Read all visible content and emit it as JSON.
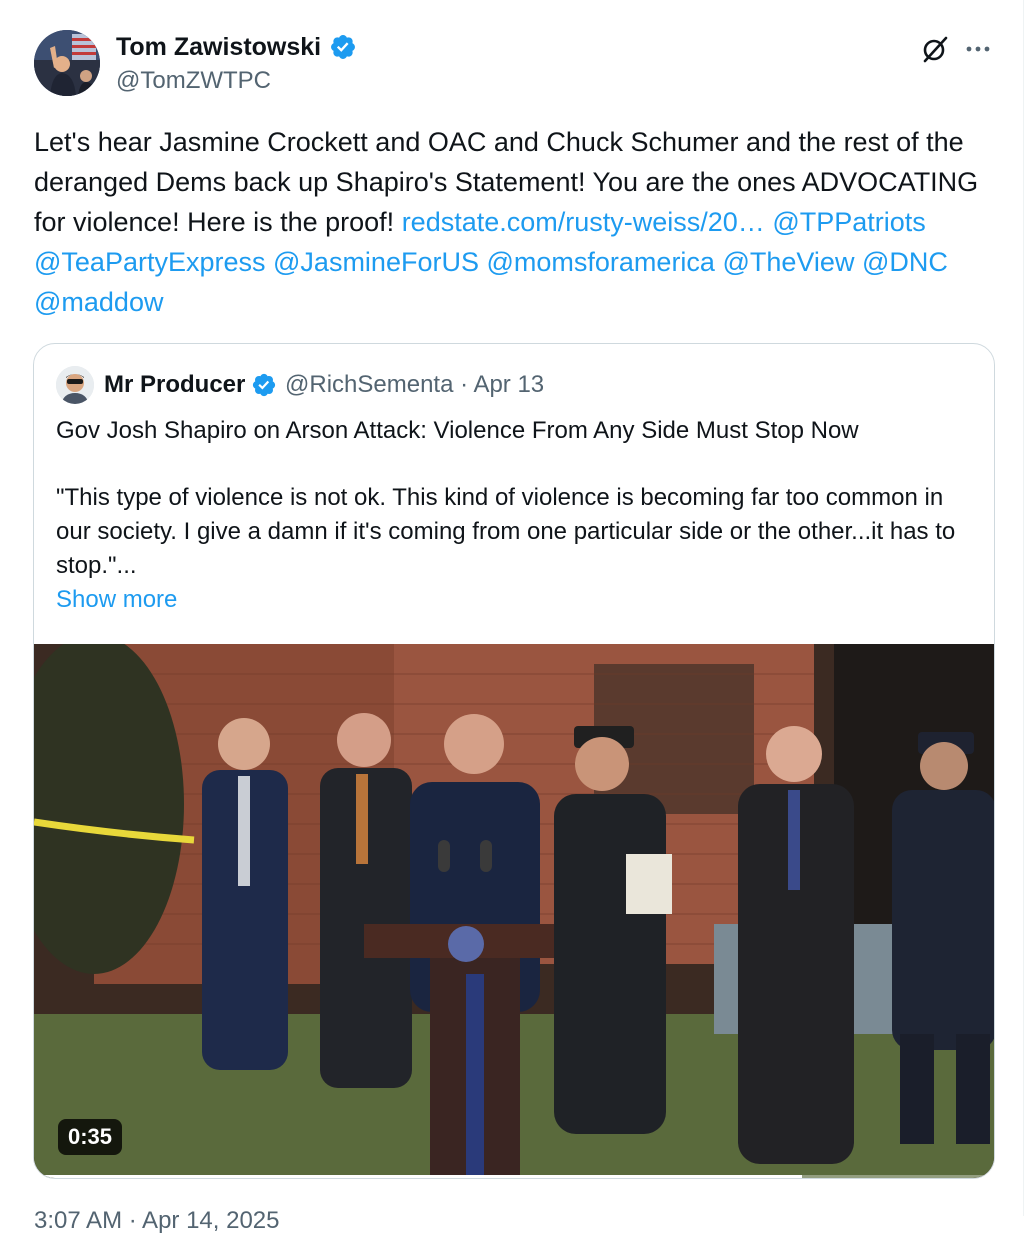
{
  "colors": {
    "link": "#1d9bf0",
    "verified_badge": "#1d9bf0",
    "secondary_text": "#536471",
    "border": "#cfd9de"
  },
  "author": {
    "name": "Tom Zawistowski",
    "handle": "@TomZWTPC",
    "verified": true,
    "avatar_icon": "profile-photo"
  },
  "header_actions": {
    "grok_icon": "grok-icon",
    "more_icon": "more-options-icon"
  },
  "tweet": {
    "text_segments": [
      {
        "text": "Let's hear Jasmine Crockett and OAC and Chuck Schumer and the rest of the deranged Dems back up Shapiro's Statement! You are the ones ADVOCATING for violence! Here is the proof! ",
        "type": "text"
      },
      {
        "text": "redstate.com/rusty-weiss/20…",
        "type": "link"
      },
      {
        "text": " ",
        "type": "text"
      },
      {
        "text": "@TPPatriots",
        "type": "link"
      },
      {
        "text": " ",
        "type": "text"
      },
      {
        "text": "@TeaPartyExpress",
        "type": "link"
      },
      {
        "text": " ",
        "type": "text"
      },
      {
        "text": "@JasmineForUS",
        "type": "link"
      },
      {
        "text": " ",
        "type": "text"
      },
      {
        "text": "@momsforamerica",
        "type": "link"
      },
      {
        "text": " ",
        "type": "text"
      },
      {
        "text": "@TheView",
        "type": "link"
      },
      {
        "text": " ",
        "type": "text"
      },
      {
        "text": "@DNC",
        "type": "link"
      },
      {
        "text": " ",
        "type": "text"
      },
      {
        "text": "@maddow",
        "type": "link"
      }
    ]
  },
  "quoted": {
    "name": "Mr Producer",
    "verified": true,
    "handle_date": "@RichSementa · Apr 13",
    "title": "Gov Josh Shapiro on Arson Attack: Violence From Any Side Must Stop Now",
    "quote": "\"This type of violence is not ok. This kind of violence is becoming far too common in our society. I give a damn if it's coming from one particular side or the other...it has to stop.\"...",
    "show_more": "Show more",
    "video": {
      "duration": "0:35",
      "progress": 0.8
    }
  },
  "timestamp": "3:07 AM · Apr 14, 2025"
}
